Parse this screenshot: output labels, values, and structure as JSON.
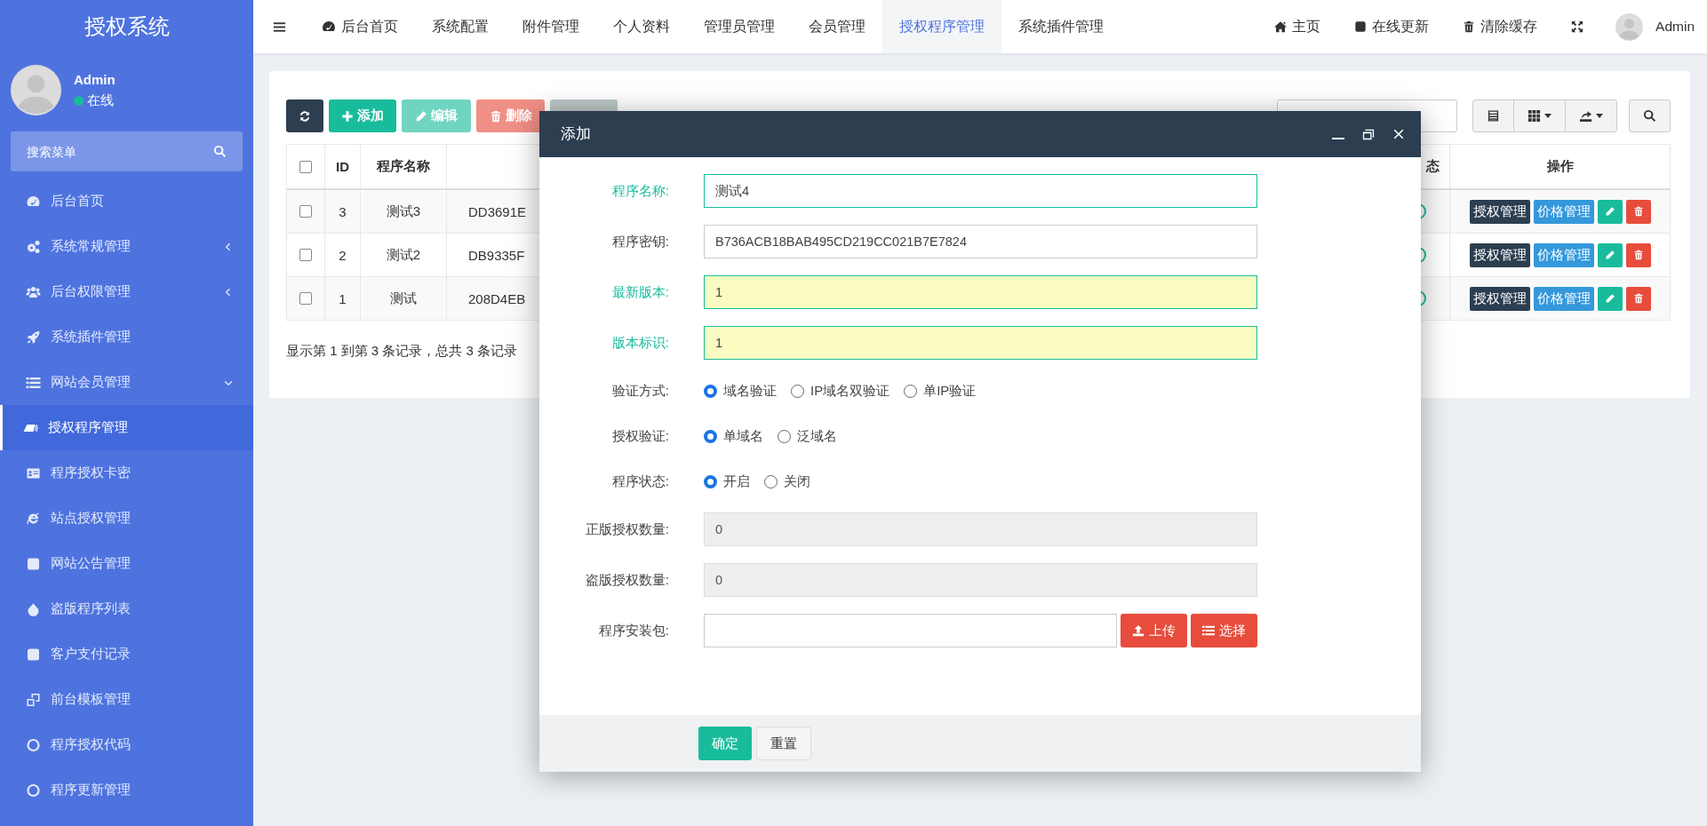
{
  "sidebar": {
    "title": "授权系统",
    "user": {
      "name": "Admin",
      "status": "在线",
      "online": true
    },
    "search": {
      "placeholder": "搜索菜单"
    },
    "items": [
      {
        "label": "后台首页",
        "kind": "link",
        "selected": false
      },
      {
        "label": "系统常规管理",
        "kind": "group",
        "expanded": false,
        "selected": false
      },
      {
        "label": "后台权限管理",
        "kind": "group",
        "expanded": false,
        "selected": false
      },
      {
        "label": "系统插件管理",
        "kind": "link",
        "selected": false
      },
      {
        "label": "网站会员管理",
        "kind": "group",
        "expanded": true,
        "selected": false
      },
      {
        "label": "授权程序管理",
        "kind": "link",
        "selected": true
      },
      {
        "label": "程序授权卡密",
        "kind": "link",
        "selected": false
      },
      {
        "label": "站点授权管理",
        "kind": "link",
        "selected": false
      },
      {
        "label": "网站公告管理",
        "kind": "link",
        "selected": false
      },
      {
        "label": "盗版程序列表",
        "kind": "link",
        "selected": false
      },
      {
        "label": "客户支付记录",
        "kind": "link",
        "selected": false
      },
      {
        "label": "前台模板管理",
        "kind": "link",
        "selected": false
      },
      {
        "label": "程序授权代码",
        "kind": "link",
        "selected": false
      },
      {
        "label": "程序更新管理",
        "kind": "link",
        "selected": false
      }
    ]
  },
  "topnav": {
    "tabs": [
      {
        "label": "后台首页",
        "selected": false
      },
      {
        "label": "系统配置",
        "selected": false
      },
      {
        "label": "附件管理",
        "selected": false
      },
      {
        "label": "个人资料",
        "selected": false
      },
      {
        "label": "管理员管理",
        "selected": false
      },
      {
        "label": "会员管理",
        "selected": false
      },
      {
        "label": "授权程序管理",
        "selected": true
      },
      {
        "label": "系统插件管理",
        "selected": false
      }
    ],
    "links": [
      {
        "label": "主页"
      },
      {
        "label": "在线更新"
      },
      {
        "label": "清除缓存"
      }
    ],
    "user": "Admin"
  },
  "toolbar": {
    "buttons": [
      {
        "kind": "refresh",
        "disabled": false
      },
      {
        "kind": "add",
        "label": "添加",
        "disabled": false
      },
      {
        "kind": "edit",
        "label": "编辑",
        "disabled": true
      },
      {
        "kind": "delete",
        "label": "删除",
        "disabled": true
      },
      {
        "kind": "more",
        "disabled": true
      }
    ]
  },
  "table": {
    "header_checked": false,
    "columns": [
      {
        "kind": "check"
      },
      {
        "kind": "id",
        "label": "ID"
      },
      {
        "kind": "name",
        "label": "程序名称"
      },
      {
        "kind": "key"
      },
      {
        "kind": "status",
        "label": "态"
      },
      {
        "kind": "actions",
        "label": "操作"
      }
    ],
    "rows": [
      {
        "checked": false,
        "id": "3",
        "name": "测试3",
        "key": "DD3691E",
        "on": true,
        "actions": [
          "授权管理",
          "价格管理"
        ]
      },
      {
        "checked": false,
        "id": "2",
        "name": "测试2",
        "key": "DB9335F",
        "on": true,
        "actions": [
          "授权管理",
          "价格管理"
        ]
      },
      {
        "checked": false,
        "id": "1",
        "name": "测试",
        "key": "208D4EB",
        "on": true,
        "actions": [
          "授权管理",
          "价格管理"
        ]
      }
    ],
    "pagination": "显示第 1 到第 3 条记录，总共 3 条记录"
  },
  "modal": {
    "title": "添加",
    "fields": [
      {
        "kind": "text",
        "label": "程序名称:",
        "value": "测试4",
        "valid": true,
        "autofilled": false,
        "disabled": false
      },
      {
        "kind": "text",
        "label": "程序密钥:",
        "value": "B736ACB18BAB495CD219CC021B7E7824",
        "valid": false,
        "autofilled": false,
        "disabled": false
      },
      {
        "kind": "text",
        "label": "最新版本:",
        "value": "1",
        "valid": true,
        "autofilled": true,
        "disabled": false
      },
      {
        "kind": "text",
        "label": "版本标识:",
        "value": "1",
        "valid": true,
        "autofilled": true,
        "disabled": false
      },
      {
        "kind": "radio",
        "label": "验证方式:",
        "options": [
          {
            "label": "域名验证",
            "selected": true
          },
          {
            "label": "IP域名双验证",
            "selected": false
          },
          {
            "label": "单IP验证",
            "selected": false
          }
        ]
      },
      {
        "kind": "radio",
        "label": "授权验证:",
        "options": [
          {
            "label": "单域名",
            "selected": true
          },
          {
            "label": "泛域名",
            "selected": false
          }
        ]
      },
      {
        "kind": "radio",
        "label": "程序状态:",
        "options": [
          {
            "label": "开启",
            "selected": true
          },
          {
            "label": "关闭",
            "selected": false
          }
        ]
      },
      {
        "kind": "text",
        "label": "正版授权数量:",
        "value": "0",
        "valid": false,
        "autofilled": false,
        "disabled": true
      },
      {
        "kind": "text",
        "label": "盗版授权数量:",
        "value": "0",
        "valid": false,
        "autofilled": false,
        "disabled": true
      },
      {
        "kind": "file",
        "label": "程序安装包:",
        "buttons": [
          "上传",
          "选择"
        ]
      }
    ],
    "footer": [
      "确定",
      "重置"
    ]
  }
}
